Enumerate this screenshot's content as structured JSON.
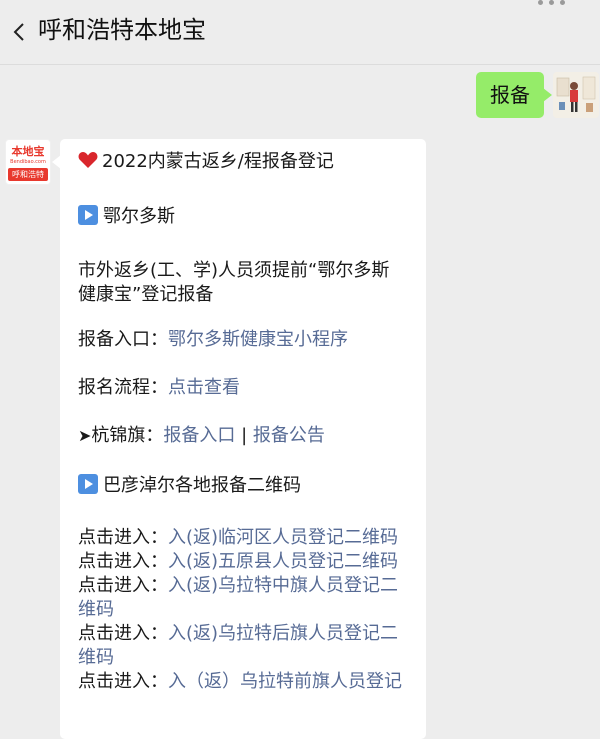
{
  "header": {
    "title": "呼和浩特本地宝"
  },
  "outgoing": {
    "text": "报备"
  },
  "source_avatar": {
    "logo_text": "本地宝",
    "logo_sub": "Bendibao.com",
    "logo_band": "呼和浩特"
  },
  "message": {
    "headline": "2022内蒙古返乡/程报备登记",
    "section1": "鄂尔多斯",
    "para1_line1": "市外返乡(工、学)人员须提前“鄂尔多斯",
    "para1_line2": "健康宝”登记报备",
    "entry_label": "报备入口：",
    "entry_link": "鄂尔多斯健康宝小程序",
    "flow_label": "报名流程：",
    "flow_link": "点击查看",
    "hangjin_label": "杭锦旗：",
    "hangjin_link1": "报备入口",
    "hangjin_sep": " | ",
    "hangjin_link2": "报备公告",
    "section2": "巴彦淖尔各地报备二维码",
    "click_label": "点击进入：",
    "qr_links": [
      "入(返)临河区人员登记二维码",
      "入(返)五原县人员登记二维码",
      "入(返)乌拉特中旗人员登记二",
      "维码",
      "入(返)乌拉特后旗人员登记二",
      "维码",
      "入（返）乌拉特前旗人员登记"
    ]
  },
  "colors": {
    "background": "#ededed",
    "outgoing_bubble": "#95ec69",
    "link": "#576b95",
    "brand_red": "#e8382d",
    "play_icon": "#4d8fe0"
  }
}
